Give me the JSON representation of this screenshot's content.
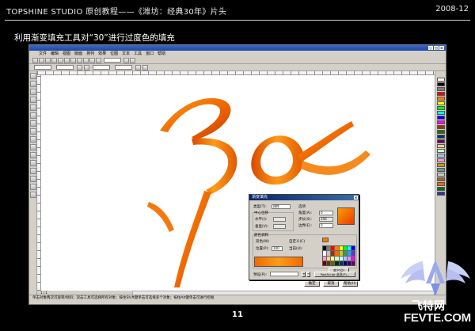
{
  "header": {
    "title": "TOPSHINE STUDIO 原创教程——《潍坊：经典30年》片头",
    "date": "2008-12"
  },
  "subtitle": "利用渐变填充工具对“30”进行过度色的填充",
  "app": {
    "menu": [
      "文件",
      "编辑",
      "视图",
      "版面",
      "排列",
      "效果",
      "位图",
      "文本",
      "工具",
      "窗口",
      "帮助"
    ],
    "page_tab": "1 / 1",
    "status_text": "单击对象两次可旋转/倾斜；双击工具可选择所有对象；按住Shift键单击可选择多个对象；按住Alt键单击可进行挖掘"
  },
  "dialog": {
    "title": "渐变填充",
    "type_label": "类型(T):",
    "type_value": "线性",
    "center_label": "中心位移",
    "horizontal_label": "水平(I):",
    "vertical_label": "垂直(V):",
    "options_label": "选项",
    "angle_label": "角度(A):",
    "angle_value": "0",
    "steps_label": "步长(S):",
    "steps_value": "256",
    "edge_label": "边界(E):",
    "edge_value": "0",
    "color_blend_label": "颜色调和",
    "two_color_label": "双色(W)",
    "custom_label": "自定义(C)",
    "position_label": "位置(P):",
    "position_value": "100",
    "current_label": "当前(U):",
    "other_button": "其它(O)",
    "preset_label": "预设(R):",
    "postscript_button": "PostScript 选项(P)...",
    "ok_button": "确定",
    "cancel_button": "取消",
    "help_button": "帮助(H)"
  },
  "page_number": "11",
  "watermark": {
    "cn": "飞特网",
    "en": "FEVTE.COM"
  },
  "colors": {
    "accent_orange": "#ff7a00",
    "ribbon_dark": "#d84a00",
    "ribbon_light": "#ff9a1a",
    "dialog_title_blue": "#0a246a"
  }
}
